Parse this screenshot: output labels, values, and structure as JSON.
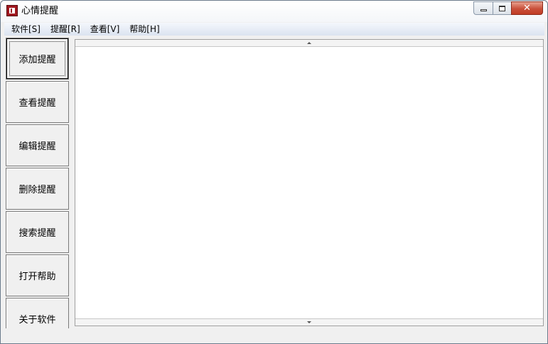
{
  "window": {
    "title": "心情提醒",
    "caption": {
      "minimize": "minimize",
      "maximize": "maximize",
      "close": "✕"
    }
  },
  "menubar": {
    "items": [
      "软件[S]",
      "提醒[R]",
      "查看[V]",
      "帮助[H]"
    ]
  },
  "sidebar": {
    "buttons": [
      "添加提醒",
      "查看提醒",
      "编辑提醒",
      "删除提醒",
      "搜索提醒",
      "打开帮助",
      "关于软件"
    ],
    "active_index": 0
  },
  "icons": {
    "app": "app-icon",
    "scroll_up": "scroll-up-arrow-icon",
    "scroll_down": "scroll-down-arrow-icon"
  },
  "colors": {
    "app_icon": "#a01820",
    "close_button": "#c9503a",
    "menubar_top": "#f4f7fc",
    "menubar_bottom": "#dbe3f0"
  }
}
